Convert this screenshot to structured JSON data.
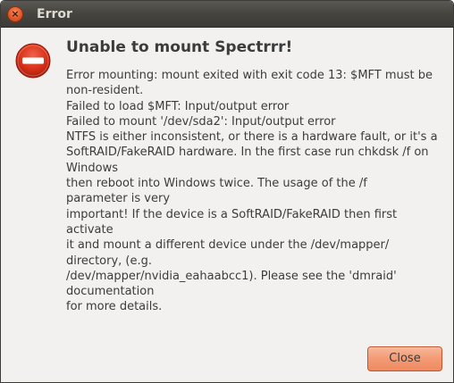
{
  "window": {
    "title": "Error",
    "close_glyph": "×"
  },
  "dialog": {
    "icon": "error-icon",
    "heading": "Unable to mount Spectrrr!",
    "message_lines": [
      "Error mounting: mount exited with exit code 13: $MFT must be",
      "non-resident.",
      "Failed to load $MFT: Input/output error",
      "Failed to mount '/dev/sda2': Input/output error",
      "NTFS is either inconsistent, or there is a hardware fault, or it's a",
      "SoftRAID/FakeRAID hardware. In the first case run chkdsk /f on",
      "Windows",
      "then reboot into Windows twice. The usage of the /f",
      "parameter is very",
      "important! If the device is a SoftRAID/FakeRAID then first",
      "activate",
      "it and mount a different device under the /dev/mapper/",
      "directory, (e.g.",
      "/dev/mapper/nvidia_eahaabcc1). Please see the 'dmraid'",
      "documentation",
      "for more details."
    ]
  },
  "buttons": {
    "close_label": "Close"
  },
  "colors": {
    "titlebar": "#3c3b37",
    "accent": "#f39a74",
    "error_red": "#d9321a"
  }
}
